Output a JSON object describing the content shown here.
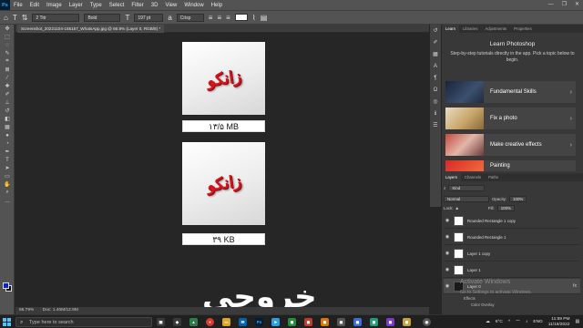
{
  "menubar": {
    "app_logo": "Ps",
    "items": [
      "File",
      "Edit",
      "Image",
      "Layer",
      "Type",
      "Select",
      "Filter",
      "3D",
      "View",
      "Window",
      "Help"
    ],
    "window_controls": [
      "—",
      "❐",
      "✕"
    ]
  },
  "options": {
    "font_family": "2 Titr",
    "font_style": "Bold",
    "font_size": "197 pt",
    "antialias": "Crisp",
    "text_color": "#ffffff"
  },
  "document": {
    "tab_title": "Screenshot_20221104-155157_WhatsApp.jpg @ 66.8% (Layer 0, RGB/8) *",
    "captions": [
      "۱۳/۵ MB",
      "۳۹ KB"
    ],
    "logo_text": "زانکو",
    "overlay_text": "خروجی",
    "zoom": "66.79%",
    "doc_info": "Doc: 1.40M/12.9M",
    "watermark_title": "Activate Windows",
    "watermark_sub": "Go to Settings to activate Windows."
  },
  "learn": {
    "tabs": [
      "Learn",
      "Libraries",
      "Adjustments",
      "Properties"
    ],
    "title": "Learn Photoshop",
    "subtitle": "Step-by-step tutorials directly in the app. Pick a topic below to begin.",
    "tutorials": [
      "Fundamental Skills",
      "Fix a photo",
      "Make creative effects",
      "Painting"
    ]
  },
  "layers_panel": {
    "tabs": [
      "Layers",
      "Channels",
      "Paths"
    ],
    "filter": "Kind",
    "blend_mode": "Normal",
    "opacity_label": "Opacity:",
    "opacity": "100%",
    "lock_label": "Lock:",
    "fill_label": "Fill:",
    "fill": "100%",
    "layers": [
      {
        "name": "Rounded Rectangle 1 copy",
        "selected": false
      },
      {
        "name": "Rounded Rectangle 1",
        "selected": false
      },
      {
        "name": "Layer 1 copy",
        "selected": false
      },
      {
        "name": "Layer 1",
        "selected": false
      },
      {
        "name": "Layer 0",
        "selected": true
      }
    ],
    "effects_label": "Effects",
    "effect": "Color Overlay"
  },
  "taskbar": {
    "search_placeholder": "Type here to search",
    "weather": "6°C",
    "language": "ENG",
    "time": "11:59 PM",
    "date": "11/19/2022"
  },
  "colors": {
    "foreground": "#0024d6",
    "background": "#000000",
    "accent": "#31a8ff",
    "logo_red": "#d7141b"
  }
}
